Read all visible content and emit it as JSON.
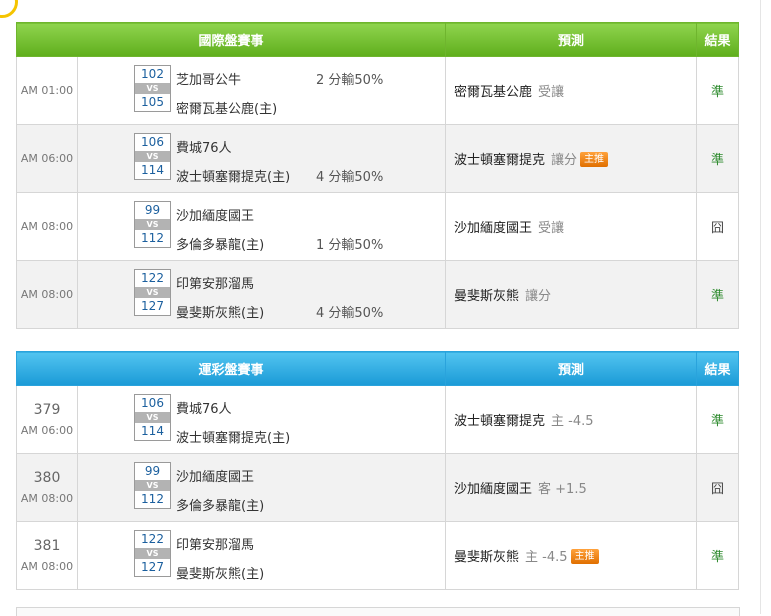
{
  "international": {
    "headers": {
      "game": "國際盤賽事",
      "prediction": "預測",
      "result": "結果"
    },
    "rows": [
      {
        "num": "",
        "time": "AM 01:00",
        "away_score": "102",
        "home_score": "105",
        "away_team": "芝加哥公牛",
        "home_team": "密爾瓦基公鹿(主)",
        "spread_top": "2 分輸50%",
        "spread_bottom": "",
        "pred_team": "密爾瓦基公鹿",
        "pred_type": "受讓",
        "badge": "",
        "result": "準"
      },
      {
        "num": "",
        "time": "AM 06:00",
        "away_score": "106",
        "home_score": "114",
        "away_team": "費城76人",
        "home_team": "波士頓塞爾提克(主)",
        "spread_top": "",
        "spread_bottom": "4 分輸50%",
        "pred_team": "波士頓塞爾提克",
        "pred_type": "讓分",
        "badge": "主推",
        "result": "準"
      },
      {
        "num": "",
        "time": "AM 08:00",
        "away_score": "99",
        "home_score": "112",
        "away_team": "沙加緬度國王",
        "home_team": "多倫多暴龍(主)",
        "spread_top": "",
        "spread_bottom": "1 分輸50%",
        "pred_team": "沙加緬度國王",
        "pred_type": "受讓",
        "badge": "",
        "result": "囧"
      },
      {
        "num": "",
        "time": "AM 08:00",
        "away_score": "122",
        "home_score": "127",
        "away_team": "印第安那溜馬",
        "home_team": "曼斐斯灰熊(主)",
        "spread_top": "",
        "spread_bottom": "4 分輸50%",
        "pred_team": "曼斐斯灰熊",
        "pred_type": "讓分",
        "badge": "",
        "result": "準"
      }
    ]
  },
  "lottery": {
    "headers": {
      "game": "運彩盤賽事",
      "prediction": "預測",
      "result": "結果"
    },
    "rows": [
      {
        "num": "379",
        "time": "AM 06:00",
        "away_score": "106",
        "home_score": "114",
        "away_team": "費城76人",
        "home_team": "波士頓塞爾提克(主)",
        "spread_top": "",
        "spread_bottom": "",
        "pred_team": "波士頓塞爾提克",
        "pred_type": "主 -4.5",
        "badge": "",
        "result": "準"
      },
      {
        "num": "380",
        "time": "AM 08:00",
        "away_score": "99",
        "home_score": "112",
        "away_team": "沙加緬度國王",
        "home_team": "多倫多暴龍(主)",
        "spread_top": "",
        "spread_bottom": "",
        "pred_team": "沙加緬度國王",
        "pred_type": "客 +1.5",
        "badge": "",
        "result": "囧"
      },
      {
        "num": "381",
        "time": "AM 08:00",
        "away_score": "122",
        "home_score": "127",
        "away_team": "印第安那溜馬",
        "home_team": "曼斐斯灰熊(主)",
        "spread_top": "",
        "spread_bottom": "",
        "pred_team": "曼斐斯灰熊",
        "pred_type": "主 -4.5",
        "badge": "主推",
        "result": "準"
      }
    ]
  },
  "vs_label": "VS",
  "colors": {
    "intl_header": "#6cbf24",
    "lottery_header": "#22a5e0",
    "win": "#2e8b2e",
    "badge": "#f08a1c"
  }
}
